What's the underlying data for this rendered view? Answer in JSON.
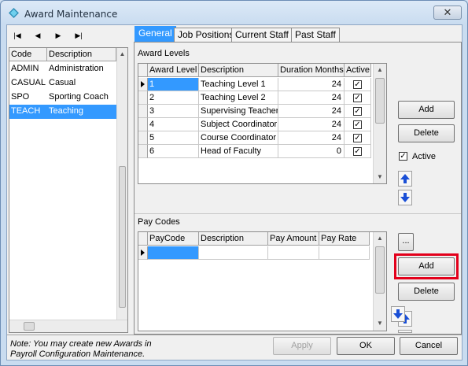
{
  "window": {
    "title": "Award Maintenance",
    "close_glyph": "✕"
  },
  "navigator": {
    "first": "|◀",
    "prev": "◀",
    "next": "▶",
    "last": "▶|"
  },
  "awards_list": {
    "columns": [
      "Code",
      "Description"
    ],
    "rows": [
      [
        "ADMIN",
        "Administration"
      ],
      [
        "CASUAL",
        "Casual"
      ],
      [
        "SPO",
        "Sporting Coach"
      ],
      [
        "TEACH",
        "Teaching"
      ]
    ],
    "selected_index": 3
  },
  "tabs": [
    "General",
    "Job Positions",
    "Current Staff",
    "Past Staff"
  ],
  "award_levels": {
    "label": "Award Levels",
    "columns": [
      "Award Level",
      "Description",
      "Duration Months",
      "Active"
    ],
    "rows": [
      [
        "1",
        "Teaching Level 1",
        "24",
        "✓"
      ],
      [
        "2",
        "Teaching Level 2",
        "24",
        "✓"
      ],
      [
        "3",
        "Supervising Teacher",
        "24",
        "✓"
      ],
      [
        "4",
        "Subject Coordinator",
        "24",
        "✓"
      ],
      [
        "5",
        "Course Coordinator",
        "24",
        "✓"
      ],
      [
        "6",
        "Head of Faculty",
        "0",
        "✓"
      ]
    ],
    "add_label": "Add",
    "delete_label": "Delete",
    "active_label": "Active",
    "active_checked": "✓"
  },
  "pay_codes": {
    "label": "Pay Codes",
    "columns": [
      "PayCode",
      "Description",
      "Pay Amount",
      "Pay Rate"
    ],
    "ellipsis_label": "...",
    "add_label": "Add",
    "delete_label": "Delete"
  },
  "footer": {
    "note_line1": "Note: You may create new Awards in",
    "note_line2": "Payroll Configuration Maintenance.",
    "apply_label": "Apply",
    "ok_label": "OK",
    "cancel_label": "Cancel"
  },
  "colors": {
    "selection": "#3399ff",
    "highlight": "#e3001b",
    "arrow": "#1a4fd6"
  }
}
